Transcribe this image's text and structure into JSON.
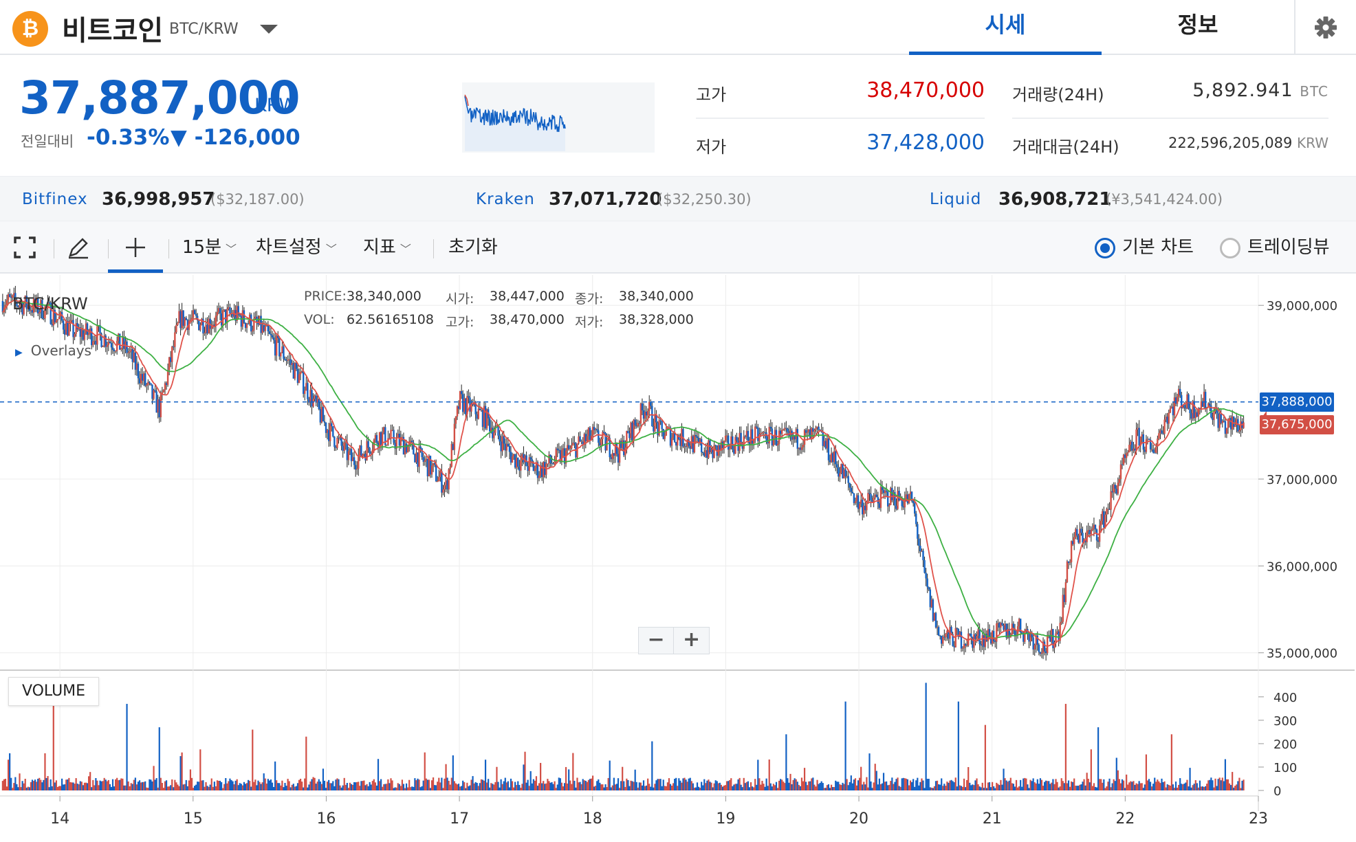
{
  "coin": {
    "name": "비트코인",
    "pair": "BTC/KRW",
    "logo": "bitcoin-logo"
  },
  "tabs": {
    "quote": "시세",
    "info": "정보"
  },
  "price": {
    "current": "37,887,000",
    "unit": "KRW",
    "change_label": "전일대비",
    "change_rate": "-0.33%",
    "change_amount": "▼ -126,000"
  },
  "stats": {
    "high_label": "고가",
    "high": "38,470,000",
    "low_label": "저가",
    "low": "37,428,000",
    "volume_label": "거래량(24H)",
    "volume": "5,892.941",
    "volume_unit": "BTC",
    "amount_label": "거래대금(24H)",
    "amount": "222,596,205,089",
    "amount_unit": "KRW"
  },
  "exchanges": [
    {
      "name": "Bitfinex",
      "price": "36,998,957",
      "usd": "($32,187.00)"
    },
    {
      "name": "Kraken",
      "price": "37,071,720",
      "usd": "($32,250.30)"
    },
    {
      "name": "Liquid",
      "price": "36,908,721",
      "usd": "(¥3,541,424.00)"
    }
  ],
  "toolbar": {
    "interval": "15분",
    "chart_settings": "차트설정",
    "indicators": "지표",
    "reset": "초기화",
    "basic_chart": "기본 차트",
    "tradingview": "트레이딩뷰"
  },
  "chart_info": {
    "title": "BTC/KRW",
    "overlays": "Overlays",
    "price_k": "PRICE:",
    "price_v": "38,340,000",
    "open_k": "시가:",
    "open_v": "38,447,000",
    "close_k": "종가:",
    "close_v": "38,340,000",
    "vol_k": "VOL:",
    "vol_v": "62.56165108",
    "high_k": "고가:",
    "high_v": "38,470,000",
    "low_k": "저가:",
    "low_v": "38,328,000",
    "current_tag": "37,888,000",
    "ma_tag": "37,675,000",
    "volume_title": "VOLUME"
  },
  "colors": {
    "up": "#d24f45",
    "down": "#1261c4",
    "ma_short": "#e0524a",
    "ma_long": "#3db043"
  },
  "chart_data": {
    "type": "line",
    "x_ticks": [
      "14",
      "15",
      "16",
      "17",
      "18",
      "19",
      "20",
      "21",
      "22",
      "23"
    ],
    "y_ticks": [
      "39,000,000",
      "37,000,000",
      "36,000,000",
      "35,000,000"
    ],
    "ylim": [
      34800000,
      39350000
    ],
    "vol_ticks": [
      "400",
      "300",
      "200",
      "100",
      "0"
    ],
    "vol_lim": [
      0,
      470
    ],
    "price_series": {
      "name": "BTC/KRW",
      "t": [
        13.6,
        13.9,
        14.1,
        14.3,
        14.5,
        14.6,
        14.75,
        14.9,
        15.1,
        15.3,
        15.5,
        15.7,
        15.85,
        16.0,
        16.2,
        16.4,
        16.6,
        16.8,
        16.9,
        17.0,
        17.2,
        17.4,
        17.6,
        17.8,
        18.0,
        18.2,
        18.4,
        18.5,
        18.7,
        18.9,
        19.1,
        19.3,
        19.5,
        19.7,
        19.9,
        20.0,
        20.2,
        20.4,
        20.5,
        20.6,
        20.8,
        21.0,
        21.2,
        21.4,
        21.5,
        21.6,
        21.8,
        22.0,
        22.1,
        22.2,
        22.3,
        22.4,
        22.5,
        22.6,
        22.75,
        22.9
      ],
      "v": [
        39050000,
        38950000,
        38700000,
        38650000,
        38500000,
        38200000,
        37800000,
        38850000,
        38800000,
        38900000,
        38750000,
        38400000,
        38050000,
        37600000,
        37200000,
        37500000,
        37400000,
        37100000,
        36900000,
        37900000,
        37700000,
        37250000,
        37100000,
        37300000,
        37500000,
        37300000,
        37850000,
        37550000,
        37450000,
        37300000,
        37450000,
        37500000,
        37450000,
        37500000,
        37000000,
        36700000,
        36800000,
        36750000,
        35800000,
        35200000,
        35150000,
        35200000,
        35300000,
        35050000,
        35250000,
        36300000,
        36400000,
        37200000,
        37500000,
        37300000,
        37700000,
        37950000,
        37800000,
        37900000,
        37600000,
        37650000
      ]
    },
    "volume_samples": {
      "t": [
        13.95,
        14.5,
        14.75,
        15.45,
        15.85,
        16.95,
        17.85,
        18.45,
        19.45,
        19.9,
        20.5,
        20.75,
        20.95,
        21.55,
        21.8,
        22.35,
        22.9
      ],
      "v": [
        410,
        370,
        270,
        260,
        230,
        150,
        160,
        210,
        240,
        380,
        460,
        380,
        280,
        370,
        270,
        240,
        110
      ]
    }
  }
}
